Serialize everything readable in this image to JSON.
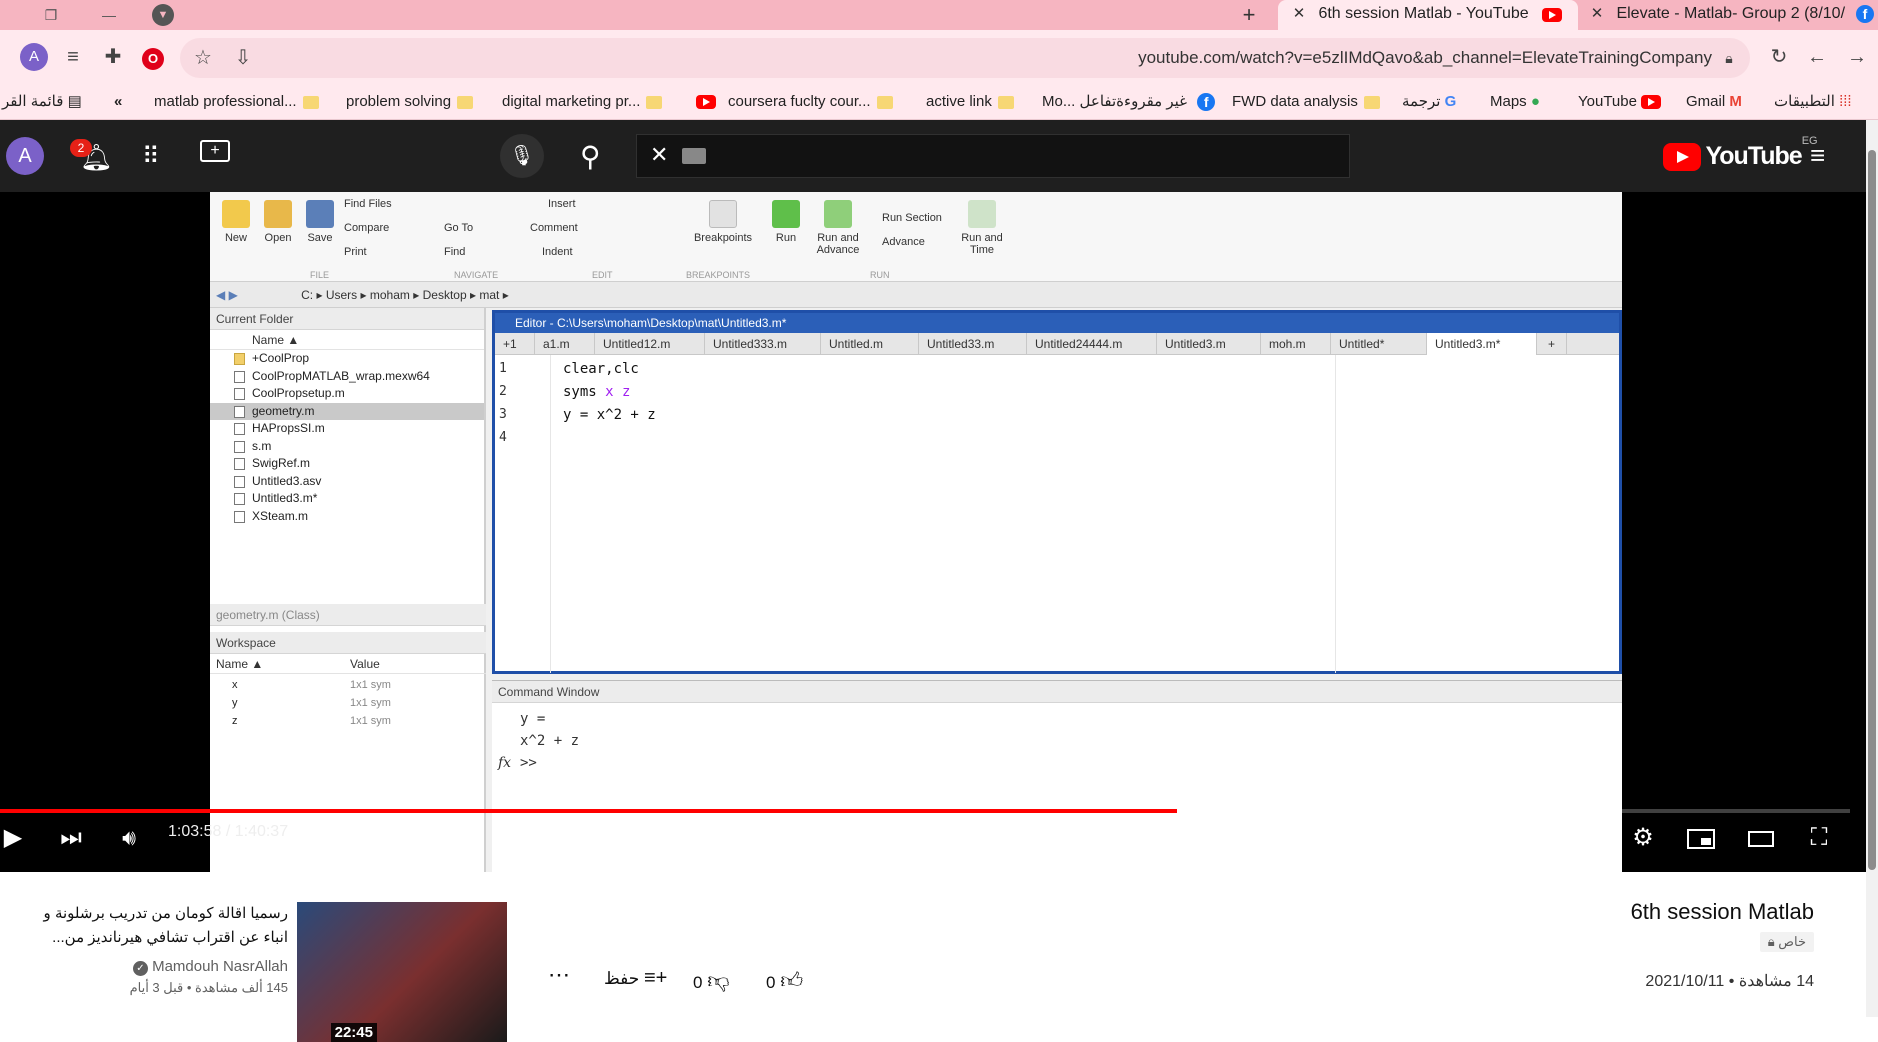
{
  "browser": {
    "tabs": [
      {
        "title": "6th session Matlab - YouTube",
        "active": true
      },
      {
        "title": "Elevate - Matlab- Group 2 (8/10/",
        "active": false
      }
    ],
    "new_tab_symbol": "+",
    "url": "youtube.com/watch?v=e5zlIMdQavo&ab_channel=ElevateTrainingCompany",
    "profile_initial": "A",
    "bookmarks": [
      "matlab professional...",
      "problem solving",
      "digital marketing pr...",
      "coursera fuclty cour...",
      "active link",
      "Mo... غير مقروءةتفاعل",
      "FWD data analysis",
      "ترجمة",
      "Maps",
      "YouTube",
      "Gmail",
      "التطبيقات"
    ],
    "bookmarks_overflow": "«",
    "reading_list": "قائمة القر"
  },
  "youtube": {
    "avatar_initial": "A",
    "notification_count": "2",
    "logo_text": "YouTube",
    "logo_region": "EG",
    "search_value": ""
  },
  "matlab": {
    "ribbon": {
      "new": "New",
      "open": "Open",
      "save": "Save",
      "find_files": "Find Files",
      "compare": "Compare",
      "print": "Print",
      "go_to": "Go To",
      "find": "Find",
      "insert": "Insert",
      "comment": "Comment",
      "indent": "Indent",
      "breakpoints": "Breakpoints",
      "run": "Run",
      "run_and_advance": "Run and\nAdvance",
      "run_section": "Run Section",
      "advance": "Advance",
      "run_and_time": "Run and\nTime",
      "groups": [
        "FILE",
        "NAVIGATE",
        "EDIT",
        "BREAKPOINTS",
        "RUN"
      ]
    },
    "path": [
      "C:",
      "Users",
      "moham",
      "Desktop",
      "mat"
    ],
    "current_folder_title": "Current Folder",
    "name_header": "Name ▲",
    "files": [
      {
        "name": "+CoolProp",
        "folder": true,
        "selected": false
      },
      {
        "name": "CoolPropMATLAB_wrap.mexw64",
        "folder": false,
        "selected": false
      },
      {
        "name": "CoolPropsetup.m",
        "folder": false,
        "selected": false
      },
      {
        "name": "geometry.m",
        "folder": false,
        "selected": true
      },
      {
        "name": "HAPropsSI.m",
        "folder": false,
        "selected": false
      },
      {
        "name": "s.m",
        "folder": false,
        "selected": false
      },
      {
        "name": "SwigRef.m",
        "folder": false,
        "selected": false
      },
      {
        "name": "Untitled3.asv",
        "folder": false,
        "selected": false
      },
      {
        "name": "Untitled3.m*",
        "folder": false,
        "selected": false
      },
      {
        "name": "XSteam.m",
        "folder": false,
        "selected": false
      }
    ],
    "details_title": "geometry.m (Class)",
    "workspace": {
      "title": "Workspace",
      "headers": [
        "Name ▲",
        "Value"
      ],
      "rows": [
        {
          "name": "x",
          "value": "1x1 sym"
        },
        {
          "name": "y",
          "value": "1x1 sym"
        },
        {
          "name": "z",
          "value": "1x1 sym"
        }
      ]
    },
    "editor": {
      "title": "Editor - C:\\Users\\moham\\Desktop\\mat\\Untitled3.m*",
      "tabs": [
        "+1",
        "a1.m",
        "Untitled12.m",
        "Untitled333.m",
        "Untitled.m",
        "Untitled33.m",
        "Untitled24444.m",
        "Untitled3.m",
        "moh.m",
        "Untitled*",
        "Untitled3.m*"
      ],
      "active_tab": "Untitled3.m*",
      "lines": [
        {
          "num": "1",
          "text": "clear,clc"
        },
        {
          "num": "2",
          "text": "syms x z"
        },
        {
          "num": "3",
          "text": "y = x^2 + z"
        },
        {
          "num": "4",
          "text": ""
        }
      ]
    },
    "command_window": {
      "title": "Command Window",
      "output": [
        "y =",
        "x^2 + z"
      ],
      "prompt": ">>",
      "fx": "fx"
    }
  },
  "player": {
    "current_time": "1:03:58",
    "duration": "1:40:37",
    "time_display": "1:03:58 / 1:40:37",
    "played_fraction": 0.636,
    "buffered_fraction": 0.655
  },
  "video": {
    "title": "6th session Matlab",
    "privacy": "خاص",
    "views": "14 مشاهدة",
    "date": "2021/10/11",
    "likes": "0",
    "dislikes": "0",
    "save_label": "حفظ"
  },
  "recommendation": {
    "title": "رسميا اقالة كومان من تدريب برشلونة و انباء عن اقتراب تشافي هيرنانديز من...",
    "channel": "Mamdouh NasrAllah",
    "meta": "145 ألف مشاهدة • قبل 3 أيام",
    "duration": "22:45"
  }
}
